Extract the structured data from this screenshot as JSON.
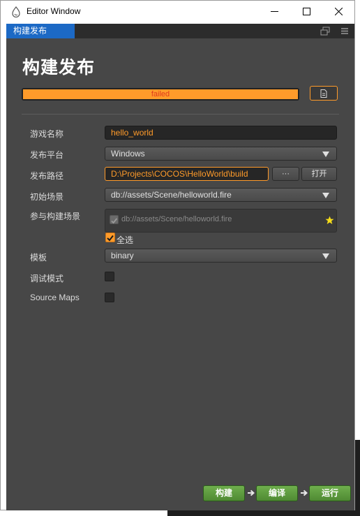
{
  "window": {
    "title": "Editor Window",
    "tab_label": "构建发布"
  },
  "panel": {
    "heading": "构建发布",
    "progress": {
      "value": 1.0,
      "status_text": "failed",
      "color": "#ff9b2a"
    }
  },
  "form": {
    "game_name": {
      "label": "游戏名称",
      "value": "hello_world"
    },
    "platform": {
      "label": "发布平台",
      "value": "Windows"
    },
    "build_path": {
      "label": "发布路径",
      "value": "D:\\Projects\\COCOS\\HelloWorld\\build",
      "browse_label": "···",
      "open_label": "打开"
    },
    "start_scene": {
      "label": "初始场景",
      "value": "db://assets/Scene/helloworld.fire"
    },
    "build_scenes": {
      "label": "参与构建场景",
      "items": [
        "db://assets/Scene/helloworld.fire"
      ],
      "select_all_label": "全选"
    },
    "template": {
      "label": "模板",
      "value": "binary"
    },
    "debug": {
      "label": "调试模式",
      "checked": false
    },
    "source_maps": {
      "label": "Source Maps",
      "checked": false
    }
  },
  "actions": {
    "build": "构建",
    "compile": "编译",
    "run": "运行"
  },
  "colors": {
    "accent": "#ff9b2a",
    "active_tab": "#1c69c5",
    "action_green": "#5e9b3f",
    "panel_bg": "#474747",
    "error_text": "#e03a1d"
  }
}
